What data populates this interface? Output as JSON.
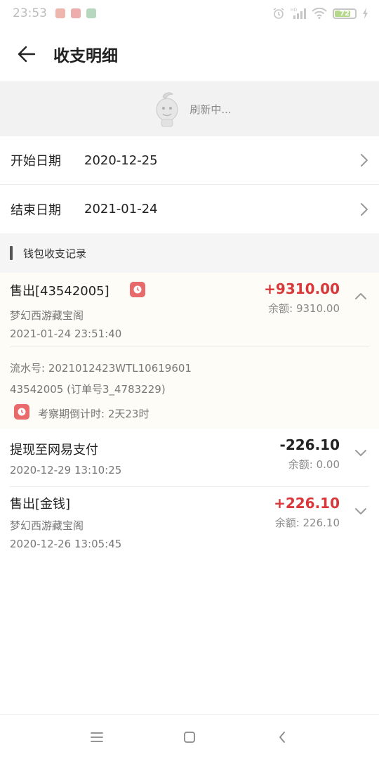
{
  "status_bar": {
    "time": "23:53",
    "battery": "72",
    "app_colors": [
      "#e07a6a",
      "#e06a6a",
      "#7ab88a"
    ]
  },
  "header": {
    "title": "收支明细",
    "back_icon": "arrow-left-icon"
  },
  "refresh": {
    "text": "刷新中..."
  },
  "filters": {
    "start_label": "开始日期",
    "start_value": "2020-12-25",
    "end_label": "结束日期",
    "end_value": "2021-01-24"
  },
  "section": {
    "title": "钱包收支记录"
  },
  "records": [
    {
      "title": "售出[43542005]",
      "subtitle": "梦幻西游藏宝阁",
      "time": "2021-01-24 23:51:40",
      "amount": "+9310.00",
      "balance": "余额: 9310.00",
      "expanded": true,
      "serial": "流水号: 2021012423WTL10619601",
      "order": "43542005 (订单号3_4783229)",
      "countdown": "考察期倒计时: 2天23时"
    },
    {
      "title": "提现至网易支付",
      "time": "2020-12-29 13:10:25",
      "amount": "-226.10",
      "balance": "余额: 0.00",
      "expanded": false
    },
    {
      "title": "售出[金钱]",
      "subtitle": "梦幻西游藏宝阁",
      "time": "2020-12-26 13:05:45",
      "amount": "+226.10",
      "balance": "余额: 226.10",
      "expanded": false
    }
  ],
  "colors": {
    "positive": "#d9383a",
    "negative": "#222222",
    "badge": "#e86a6a"
  }
}
